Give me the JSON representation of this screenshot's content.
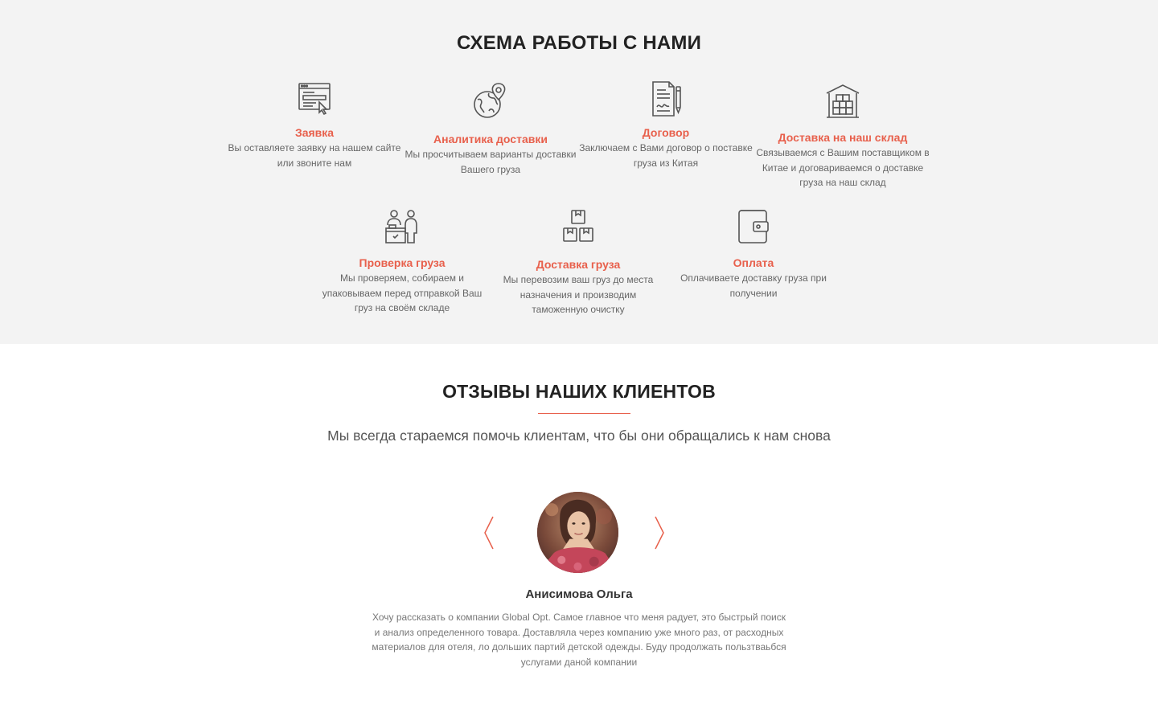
{
  "scheme": {
    "title": "СХЕМА РАБОТЫ С НАМИ",
    "accent_color": "#e8604c",
    "steps": [
      {
        "icon": "application-form-icon",
        "title": "Заявка",
        "desc": "Вы оставляете заявку на нашем сайте или звоните нам"
      },
      {
        "icon": "globe-location-icon",
        "title": "Аналитика доставки",
        "desc": "Мы просчитываем варианты доставки Вашего груза"
      },
      {
        "icon": "contract-icon",
        "title": "Договор",
        "desc": "Заключаем с Вами договор о поставке груза из Китая"
      },
      {
        "icon": "warehouse-icon",
        "title": "Доставка на наш склад",
        "desc": "Связываемся с Вашим поставщиком в Китае и договариваемся о доставке груза на наш склад"
      },
      {
        "icon": "cargo-check-icon",
        "title": "Проверка груза",
        "desc": "Мы проверяем, собираем и упаковываем перед отправкой Ваш груз на своём складе"
      },
      {
        "icon": "boxes-icon",
        "title": "Доставка груза",
        "desc": "Мы перевозим ваш груз до места назначения и производим таможенную очистку"
      },
      {
        "icon": "wallet-icon",
        "title": "Оплата",
        "desc": "Оплачиваете доставку груза при получении"
      }
    ]
  },
  "reviews": {
    "title": "ОТЗЫВЫ НАШИХ КЛИЕНТОВ",
    "subtitle": "Мы всегда стараемся помочь клиентам, что бы они обращались к нам снова",
    "prev_icon": "chevron-left-icon",
    "next_icon": "chevron-right-icon",
    "current": {
      "name": "Анисимова Ольга",
      "text": "Хочу рассказать о компании Global Opt. Самое главное что меня радует, это быстрый поиск и анализ определенного товара. Доставляла через компанию уже много раз, от расходных материалов для отеля, ло дольших партий детской одежды. Буду продолжать пользтваьбся услугами даной компании"
    }
  }
}
